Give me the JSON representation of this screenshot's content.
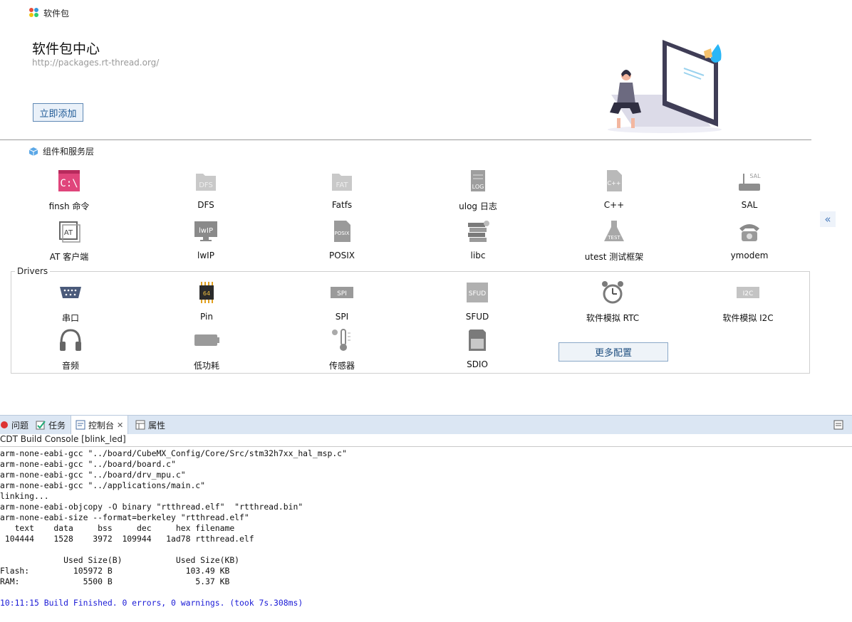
{
  "header": {
    "tab_label": "软件包",
    "title": "软件包中心",
    "url": "http://packages.rt-thread.org/",
    "add_button": "立即添加",
    "collapse_glyph": "«"
  },
  "components": {
    "section_title": "组件和服务层",
    "items": [
      {
        "label": "finsh 命令",
        "icon": "terminal-icon"
      },
      {
        "label": "DFS",
        "icon": "dfs-folder-icon"
      },
      {
        "label": "Fatfs",
        "icon": "fat-folder-icon"
      },
      {
        "label": "ulog 日志",
        "icon": "log-icon"
      },
      {
        "label": "C++",
        "icon": "cpp-file-icon"
      },
      {
        "label": "SAL",
        "icon": "router-icon"
      },
      {
        "label": "AT 客户端",
        "icon": "at-icon"
      },
      {
        "label": "lwIP",
        "icon": "lwip-monitor-icon"
      },
      {
        "label": "POSIX",
        "icon": "posix-icon"
      },
      {
        "label": "libc",
        "icon": "books-icon"
      },
      {
        "label": "utest 测试框架",
        "icon": "flask-icon"
      },
      {
        "label": "ymodem",
        "icon": "telephone-icon"
      }
    ]
  },
  "drivers": {
    "label": "Drivers",
    "items": [
      {
        "label": "串口",
        "icon": "serial-port-icon"
      },
      {
        "label": "Pin",
        "icon": "chip-icon"
      },
      {
        "label": "SPI",
        "icon": "spi-icon"
      },
      {
        "label": "SFUD",
        "icon": "sfud-icon"
      },
      {
        "label": "软件模拟 RTC",
        "icon": "alarm-clock-icon"
      },
      {
        "label": "软件模拟 I2C",
        "icon": "i2c-icon"
      },
      {
        "label": "音频",
        "icon": "headphones-icon"
      },
      {
        "label": "低功耗",
        "icon": "battery-icon"
      },
      {
        "label": "传感器",
        "icon": "thermometer-icon"
      },
      {
        "label": "SDIO",
        "icon": "sd-card-icon"
      }
    ],
    "more_button": "更多配置"
  },
  "console": {
    "tabs": [
      "问题",
      "任务",
      "控制台",
      "属性"
    ],
    "active_tab": "控制台",
    "title": "CDT Build Console [blink_led]",
    "lines": [
      "arm-none-eabi-gcc \"../board/CubeMX_Config/Core/Src/stm32h7xx_hal_msp.c\"",
      "arm-none-eabi-gcc \"../board/board.c\"",
      "arm-none-eabi-gcc \"../board/drv_mpu.c\"",
      "arm-none-eabi-gcc \"../applications/main.c\"",
      "linking...",
      "arm-none-eabi-objcopy -O binary \"rtthread.elf\"  \"rtthread.bin\"",
      "arm-none-eabi-size --format=berkeley \"rtthread.elf\"",
      "   text    data     bss     dec     hex filename",
      " 104444    1528    3972  109944   1ad78 rtthread.elf",
      "",
      "             Used Size(B)           Used Size(KB)",
      "Flash:         105972 B               103.49 KB",
      "RAM:             5500 B                 5.37 KB",
      "",
      "10:11:15 Build Finished. 0 errors, 0 warnings. (took 7s.308ms)"
    ]
  },
  "colors": {
    "accent": "#1f5a96",
    "console_finished": "#1a1ad6",
    "tab_bar": "#dbe6f3"
  }
}
